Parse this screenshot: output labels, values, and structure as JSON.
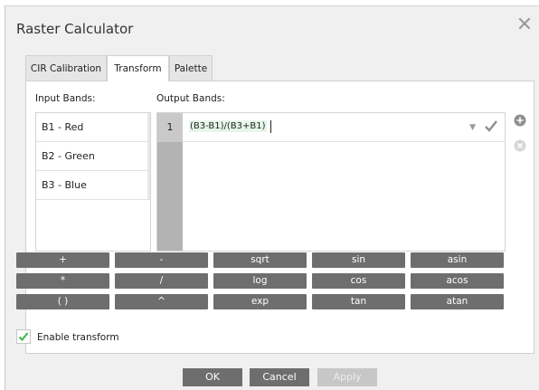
{
  "dialog": {
    "title": "Raster Calculator"
  },
  "icons": {
    "close": "close-icon",
    "add": "plus-circle-icon",
    "remove": "x-circle-icon",
    "apply_row": "checkmark-icon",
    "dropdown": "chevron-down-icon"
  },
  "tabs": [
    {
      "label": "CIR Calibration",
      "active": false
    },
    {
      "label": "Transform",
      "active": true
    },
    {
      "label": "Palette",
      "active": false
    }
  ],
  "input_bands": {
    "label": "Input Bands:",
    "items": [
      "B1 - Red",
      "B2 - Green",
      "B3 - Blue"
    ]
  },
  "output_bands": {
    "label": "Output Bands:",
    "rows": [
      {
        "index": "1",
        "expression": "(B3-B1)/(B3+B1)"
      }
    ]
  },
  "operators": [
    [
      "+",
      "-",
      "sqrt",
      "sin",
      "asin"
    ],
    [
      "*",
      "/",
      "log",
      "cos",
      "acos"
    ],
    [
      "( )",
      "^",
      "exp",
      "tan",
      "atan"
    ]
  ],
  "enable_transform": {
    "label": "Enable transform",
    "checked": true
  },
  "buttons": {
    "ok": "OK",
    "cancel": "Cancel",
    "apply": "Apply",
    "apply_enabled": false
  },
  "colors": {
    "accent_check": "#3cb44b",
    "button_bg": "#6e6e6e",
    "disabled_bg": "#c7c7c7",
    "gutter": "#b3b3b3"
  }
}
